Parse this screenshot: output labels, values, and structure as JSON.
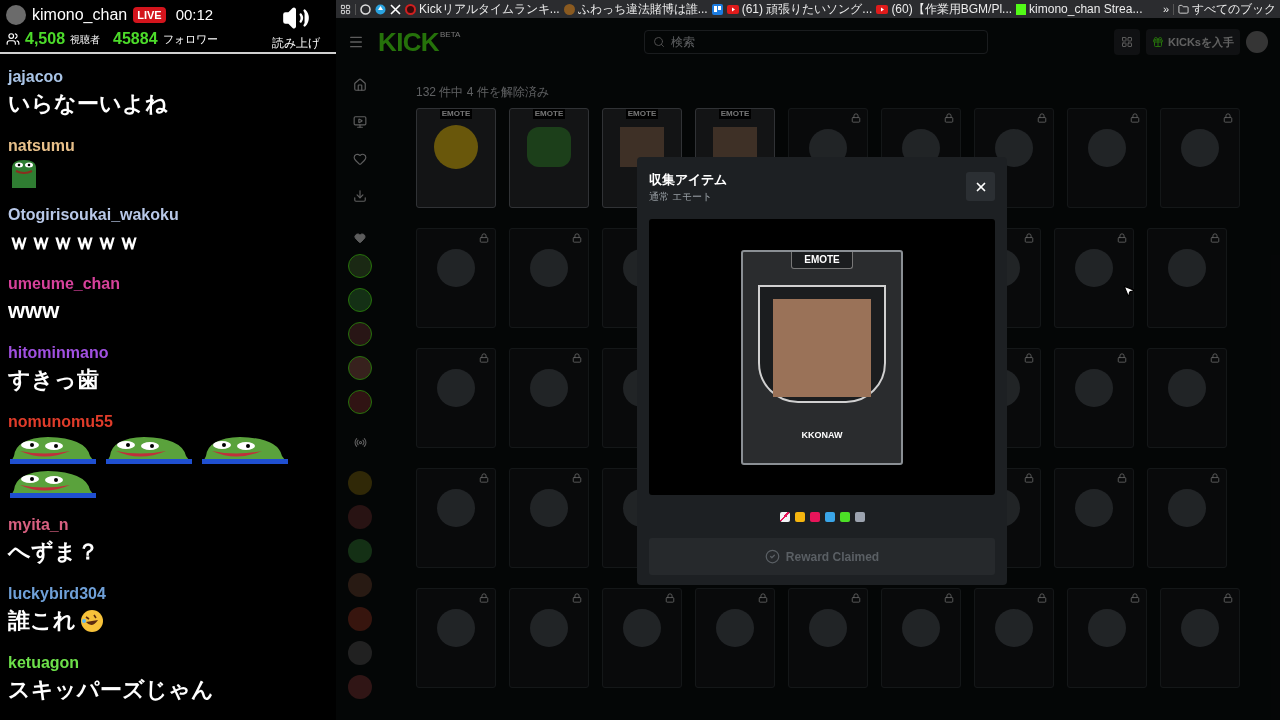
{
  "chat_header": {
    "channel": "kimono_chan",
    "live_badge": "LIVE",
    "uptime": "00:12",
    "viewers": "4,508",
    "viewers_label": "視聴者",
    "followers": "45884",
    "followers_label": "フォロワー",
    "tts_label": "読み上げ"
  },
  "chat": [
    {
      "user": "jajacoo",
      "color": "#a9c4e6",
      "kind": "text",
      "text": "いらなーいよね"
    },
    {
      "user": "natsumu",
      "color": "#e8c08a",
      "kind": "emotes",
      "emotes": [
        {
          "kind": "frog-thumb"
        }
      ]
    },
    {
      "user": "Otogirisoukai_wakoku",
      "color": "#b8c8e8",
      "kind": "text",
      "text": "ｗｗｗｗｗｗ"
    },
    {
      "user": "umeume_chan",
      "color": "#d6419a",
      "kind": "text",
      "text": "www"
    },
    {
      "user": "hitominmano",
      "color": "#a050e0",
      "kind": "text",
      "text": "すきっ歯"
    },
    {
      "user": "nomunomu55",
      "color": "#e03c2a",
      "kind": "emotes",
      "emotes": [
        {
          "kind": "frog-laugh"
        },
        {
          "kind": "frog-laugh"
        },
        {
          "kind": "frog-laugh"
        },
        {
          "kind": "frog-laugh"
        }
      ]
    },
    {
      "user": "myita_n",
      "color": "#d86080",
      "kind": "text",
      "text": "へずま？"
    },
    {
      "user": "luckybird304",
      "color": "#6fa0d8",
      "kind": "text_emoji",
      "text": "誰これ"
    },
    {
      "user": "ketuagon",
      "color": "#6de04a",
      "kind": "text",
      "text": "スキッパーズじゃん"
    }
  ],
  "bookmarks": [
    {
      "kind": "ring"
    },
    {
      "kind": "drop"
    },
    {
      "kind": "x"
    },
    {
      "kind": "red-circle",
      "label": "Kickリアルタイムランキ..."
    },
    {
      "kind": "avatar",
      "label": "ふわっち違法賭博は誰..."
    },
    {
      "kind": "board"
    },
    {
      "kind": "play",
      "label": "(61) 頑張りたいソング..."
    },
    {
      "kind": "play",
      "label": "(60)【作業用BGM/Pl..."
    },
    {
      "kind": "k",
      "label": "kimono_chan Strea..."
    }
  ],
  "bookmarks_more": "»",
  "bookmarks_folder": "すべてのブック",
  "kick_header": {
    "logo": "KICK",
    "logo_badge": "BETA",
    "search_placeholder": "検索",
    "kicks_button": "KICKsを入手"
  },
  "sidebar_nav": [
    {
      "kind": "home"
    },
    {
      "kind": "browse"
    },
    {
      "kind": "following"
    },
    {
      "kind": "download"
    }
  ],
  "collection": {
    "unlocked_summary": "132 件中 4 件を解除済み",
    "rows": [
      {
        "left": [
          {
            "locked": false,
            "kind": "emoji",
            "label": "EMOTE"
          },
          {
            "locked": false,
            "kind": "frog",
            "label": "EMOTE"
          },
          {
            "locked": false,
            "kind": "photo",
            "label": "EMOTE"
          },
          {
            "locked": false,
            "kind": "photo",
            "label": "EMOTE"
          },
          {
            "locked": true,
            "kind": "hidden"
          },
          {
            "locked": true,
            "kind": "hidden"
          },
          {
            "locked": true,
            "kind": "hidden"
          },
          {
            "locked": true,
            "kind": "hidden"
          },
          {
            "locked": true,
            "kind": "hidden"
          }
        ]
      },
      {
        "left": [
          {
            "locked": true,
            "kind": "hidden"
          },
          {
            "locked": true,
            "kind": "hidden"
          },
          {
            "locked": true,
            "kind": "hidden"
          }
        ],
        "right": [
          {
            "locked": true,
            "kind": "hidden"
          },
          {
            "locked": true,
            "kind": "hidden"
          },
          {
            "locked": true,
            "kind": "hidden"
          }
        ]
      },
      {
        "left": [
          {
            "locked": true,
            "kind": "hidden"
          },
          {
            "locked": true,
            "kind": "hidden"
          },
          {
            "locked": true,
            "kind": "hidden"
          }
        ],
        "right": [
          {
            "locked": true,
            "kind": "hidden"
          },
          {
            "locked": true,
            "kind": "hidden"
          },
          {
            "locked": true,
            "kind": "hidden"
          }
        ]
      },
      {
        "left": [
          {
            "locked": true,
            "kind": "hidden"
          },
          {
            "locked": true,
            "kind": "hidden"
          },
          {
            "locked": true,
            "kind": "hidden"
          }
        ],
        "right": [
          {
            "locked": true,
            "kind": "hidden"
          },
          {
            "locked": true,
            "kind": "hidden"
          },
          {
            "locked": true,
            "kind": "hidden"
          }
        ]
      },
      {
        "left": [
          {
            "locked": true,
            "kind": "hidden"
          },
          {
            "locked": true,
            "kind": "hidden"
          },
          {
            "locked": true,
            "kind": "hidden"
          },
          {
            "locked": true,
            "kind": "hidden"
          },
          {
            "locked": true,
            "kind": "hidden"
          },
          {
            "locked": true,
            "kind": "hidden"
          },
          {
            "locked": true,
            "kind": "hidden"
          },
          {
            "locked": true,
            "kind": "hidden"
          },
          {
            "locked": true,
            "kind": "hidden"
          }
        ]
      }
    ]
  },
  "modal": {
    "title": "収集アイテム",
    "subtitle": "通常 エモート",
    "card_label": "EMOTE",
    "card_name": "KKONAW",
    "swatches": [
      {
        "kind": "striped",
        "color": "#f3f4f6"
      },
      {
        "kind": "solid",
        "color": "#f5b50f"
      },
      {
        "kind": "solid",
        "color": "#e8155a"
      },
      {
        "kind": "solid",
        "color": "#3aa5e8"
      },
      {
        "kind": "solid",
        "color": "#4ce026"
      },
      {
        "kind": "solid",
        "color": "#9ca3af"
      }
    ],
    "button": {
      "label": "Reward Claimed",
      "disabled": true
    }
  }
}
